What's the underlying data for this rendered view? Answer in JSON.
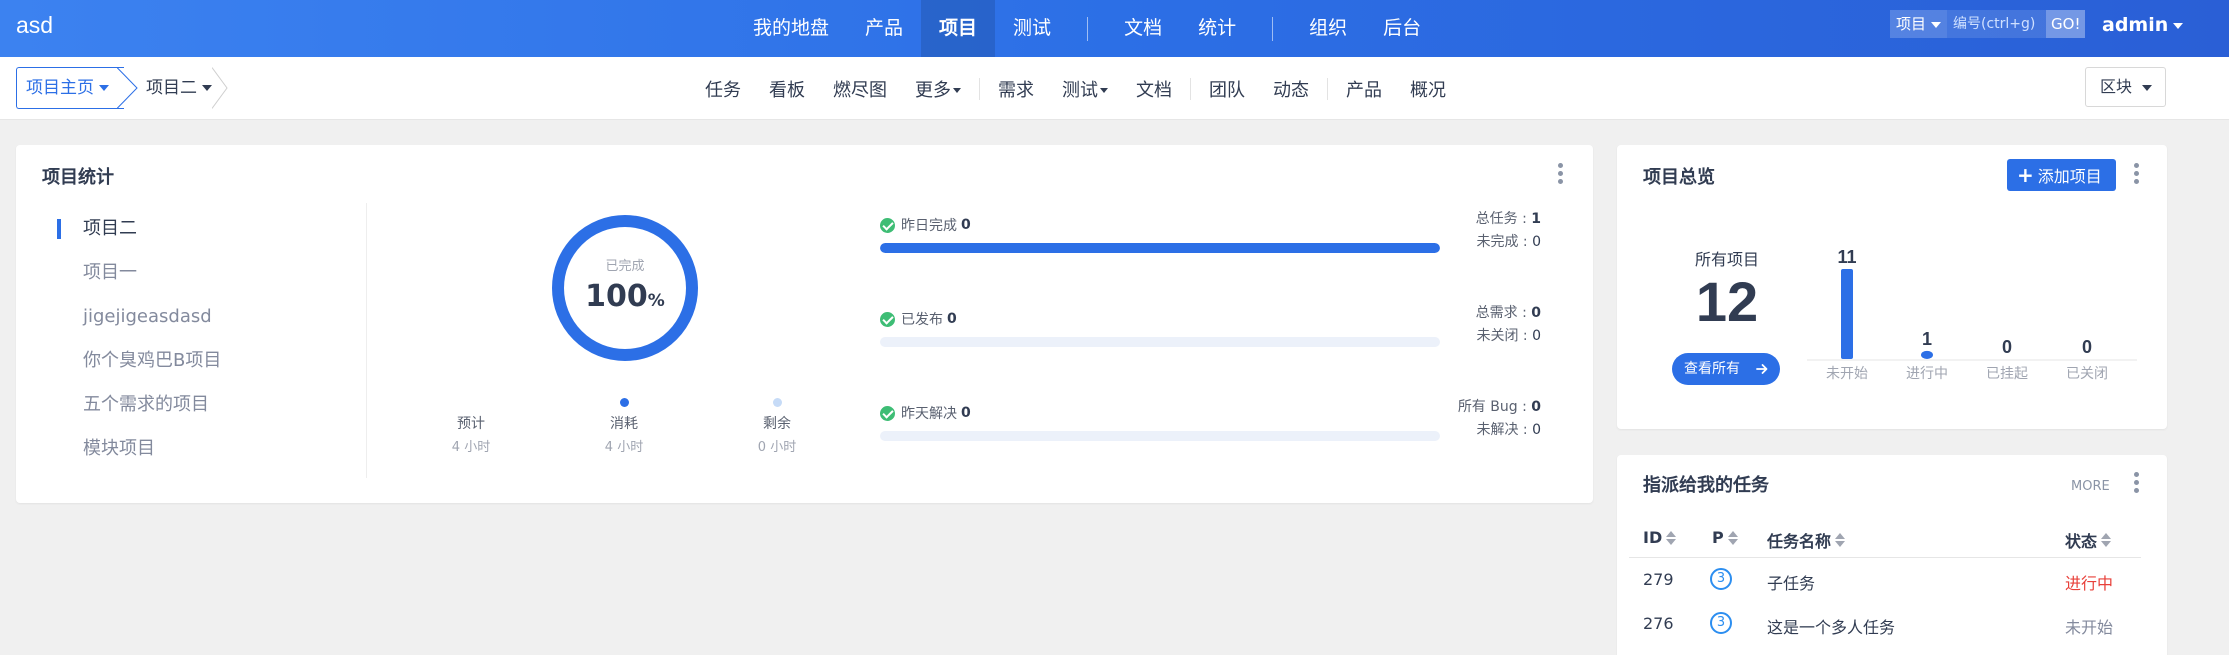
{
  "brand": "asd",
  "mainnav": {
    "items": [
      "我的地盘",
      "产品",
      "项目",
      "测试",
      "文档",
      "统计",
      "组织",
      "后台"
    ],
    "active": "项目"
  },
  "search": {
    "type": "项目",
    "placeholder": "编号(ctrl+g)",
    "go": "GO!"
  },
  "user": "admin",
  "breadcrumb": {
    "home": "项目主页",
    "current": "项目二"
  },
  "subnav": [
    "任务",
    "看板",
    "燃尽图",
    "更多",
    "需求",
    "测试",
    "文档",
    "团队",
    "动态",
    "产品",
    "概况"
  ],
  "block_button": "区块",
  "stats_card": {
    "title": "项目统计",
    "projects": [
      "项目二",
      "项目一",
      "jigejigeasdasd",
      "你个臭鸡巴B项目",
      "五个需求的项目",
      "模块项目"
    ],
    "active_project": "项目二",
    "completion": {
      "label": "已完成",
      "value": "100",
      "unit": "%",
      "percent": 100
    },
    "hours": [
      {
        "label": "预计",
        "value": "4 小时",
        "color": "#ffffff"
      },
      {
        "label": "消耗",
        "value": "4 小时",
        "color": "#2c6fe6"
      },
      {
        "label": "剩余",
        "value": "0 小时",
        "color": "#c6dbf7"
      }
    ],
    "progress": [
      {
        "label": "昨日完成",
        "count": "0",
        "fill": 1.0,
        "right": [
          {
            "label": "总任务 : ",
            "value": "1"
          },
          {
            "label": "未完成 : ",
            "value": "0"
          }
        ]
      },
      {
        "label": "已发布",
        "count": "0",
        "fill": 0.0,
        "right": [
          {
            "label": "总需求 : ",
            "value": "0"
          },
          {
            "label": "未关闭 : ",
            "value": "0"
          }
        ]
      },
      {
        "label": "昨天解决",
        "count": "0",
        "fill": 0.0,
        "right": [
          {
            "label": "所有 Bug : ",
            "value": "0"
          },
          {
            "label": "未解决 : ",
            "value": "0"
          }
        ]
      }
    ]
  },
  "overview_card": {
    "title": "项目总览",
    "add_button": "添加项目",
    "total_label": "所有项目",
    "total": "12",
    "view_all": "查看所有",
    "chart_data": {
      "type": "bar",
      "categories": [
        "未开始",
        "进行中",
        "已挂起",
        "已关闭"
      ],
      "values": [
        11,
        1,
        0,
        0
      ],
      "ylim": [
        0,
        11
      ]
    }
  },
  "tasks_card": {
    "title": "指派给我的任务",
    "more": "MORE",
    "columns": [
      "ID",
      "P",
      "任务名称",
      "状态"
    ],
    "rows": [
      {
        "id": "279",
        "p": "3",
        "name": "子任务",
        "status": "进行中",
        "status_color": "#e8403a"
      },
      {
        "id": "276",
        "p": "3",
        "name": "这是一个多人任务",
        "status": "未开始",
        "status_color": "#838a9d"
      }
    ]
  }
}
